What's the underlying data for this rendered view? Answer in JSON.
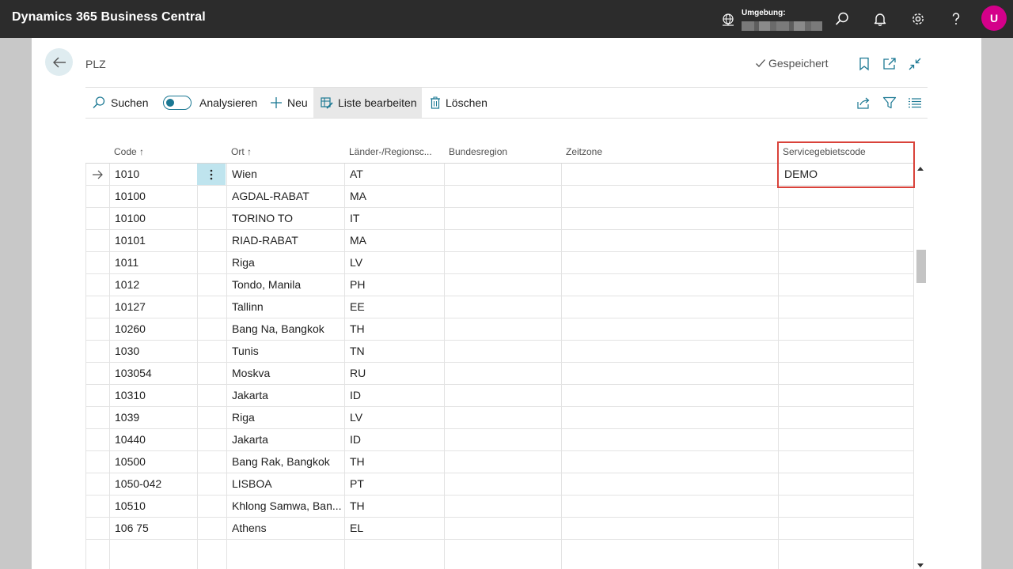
{
  "app": {
    "title": "Dynamics 365 Business Central"
  },
  "topbar": {
    "environment_label": "Umgebung:",
    "avatar_initial": "U",
    "icons": [
      "search-icon",
      "bell-icon",
      "gear-icon",
      "help-icon"
    ]
  },
  "page": {
    "title": "PLZ",
    "saved_status": "Gespeichert"
  },
  "actions": {
    "search": "Suchen",
    "analyze": "Analysieren",
    "new": "Neu",
    "edit_list": "Liste bearbeiten",
    "delete": "Löschen"
  },
  "columns": {
    "code": "Code ↑",
    "city": "Ort ↑",
    "country": "Länder-/Regionsc...",
    "county": "Bundesregion",
    "timezone": "Zeitzone",
    "service_area": "Servicegebietscode"
  },
  "rows": [
    {
      "code": "1010",
      "city": "Wien",
      "country": "AT",
      "service": "DEMO"
    },
    {
      "code": "10100",
      "city": "AGDAL-RABAT",
      "country": "MA",
      "service": ""
    },
    {
      "code": "10100",
      "city": "TORINO TO",
      "country": "IT",
      "service": ""
    },
    {
      "code": "10101",
      "city": "RIAD-RABAT",
      "country": "MA",
      "service": ""
    },
    {
      "code": "1011",
      "city": "Riga",
      "country": "LV",
      "service": ""
    },
    {
      "code": "1012",
      "city": "Tondo, Manila",
      "country": "PH",
      "service": ""
    },
    {
      "code": "10127",
      "city": "Tallinn",
      "country": "EE",
      "service": ""
    },
    {
      "code": "10260",
      "city": "Bang Na, Bangkok",
      "country": "TH",
      "service": ""
    },
    {
      "code": "1030",
      "city": "Tunis",
      "country": "TN",
      "service": ""
    },
    {
      "code": "103054",
      "city": "Moskva",
      "country": "RU",
      "service": ""
    },
    {
      "code": "10310",
      "city": "Jakarta",
      "country": "ID",
      "service": ""
    },
    {
      "code": "1039",
      "city": "Riga",
      "country": "LV",
      "service": ""
    },
    {
      "code": "10440",
      "city": "Jakarta",
      "country": "ID",
      "service": ""
    },
    {
      "code": "10500",
      "city": "Bang Rak, Bangkok",
      "country": "TH",
      "service": ""
    },
    {
      "code": "1050-042",
      "city": "LISBOA",
      "country": "PT",
      "service": ""
    },
    {
      "code": "10510",
      "city": "Khlong Samwa, Ban...",
      "country": "TH",
      "service": ""
    },
    {
      "code": "106 75",
      "city": "Athens",
      "country": "EL",
      "service": ""
    }
  ]
}
